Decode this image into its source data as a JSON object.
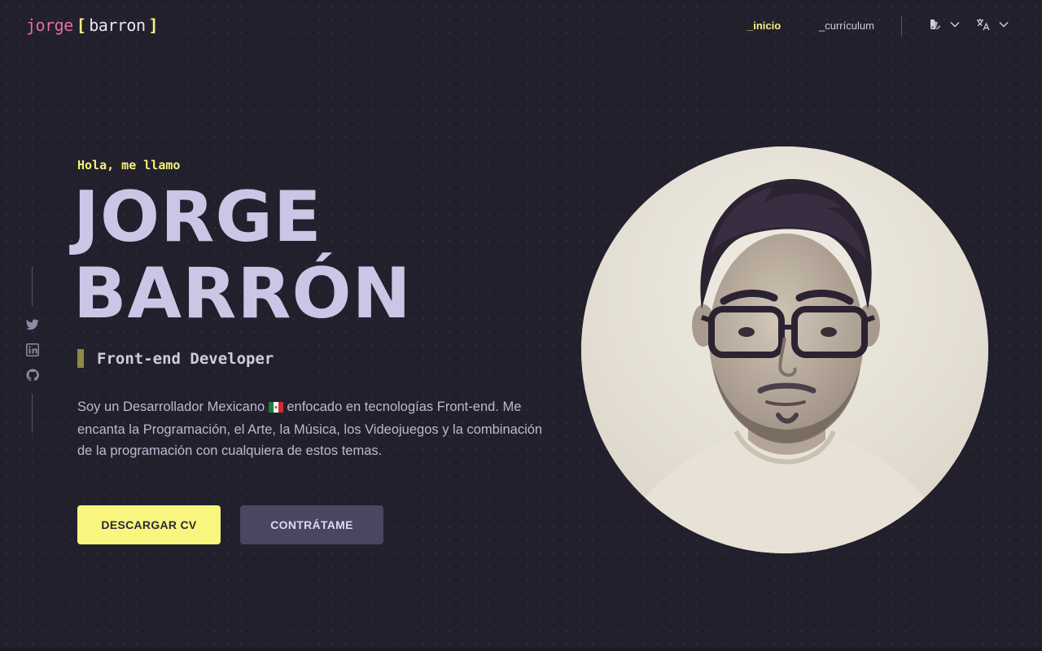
{
  "logo": {
    "first": "jorge",
    "open_bracket": "[",
    "last": "barron",
    "close_bracket": "]"
  },
  "nav": {
    "home": "_inicio",
    "curriculum": "_currículum"
  },
  "header_controls": {
    "theme_icon": "theme-palette-icon",
    "language_icon": "translate-icon"
  },
  "social": [
    {
      "name": "twitter",
      "icon": "twitter-icon"
    },
    {
      "name": "linkedin",
      "icon": "linkedin-icon"
    },
    {
      "name": "github",
      "icon": "github-icon"
    }
  ],
  "hero": {
    "greeting": "Hola, me llamo",
    "name_line1": "JORGE",
    "name_line2": "BARRÓN",
    "role": "Front-end Developer",
    "bio_before_flag": "Soy un Desarrollador Mexicano ",
    "bio_after_flag": " enfocado en tecnologías Front-end. Me encanta la Programación, el Arte, la Música, los Videojuegos y la combinación de la programación con cualquiera de estos temas."
  },
  "buttons": {
    "download_cv": "DESCARGAR CV",
    "hire": "CONTRÁTAME"
  },
  "colors": {
    "background": "#22202c",
    "accent_yellow": "#f4f07a",
    "logo_pink": "#e26fa0",
    "name_lavender": "#c9c6e6",
    "secondary_button": "#4a4560"
  }
}
